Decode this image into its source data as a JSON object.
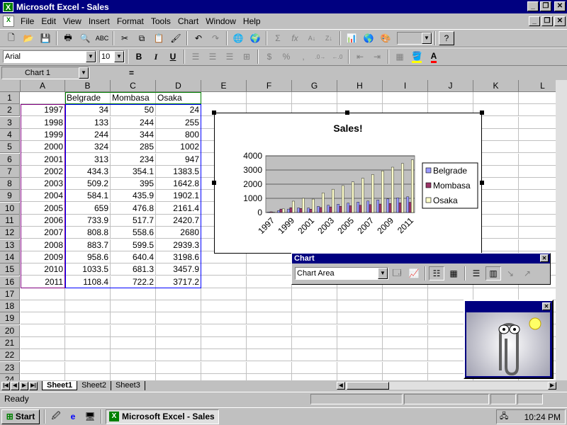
{
  "window": {
    "title": "Microsoft Excel - Sales",
    "minimize": "_",
    "restore": "❐",
    "close": "✕"
  },
  "menu": [
    "File",
    "Edit",
    "View",
    "Insert",
    "Format",
    "Tools",
    "Chart",
    "Window",
    "Help"
  ],
  "toolbar_std": {
    "zoom_value": ""
  },
  "toolbar_fmt": {
    "font": "Arial",
    "size": "10",
    "bold": "B",
    "italic": "I",
    "underline": "U",
    "currency": "$",
    "percent": "%",
    "comma": ","
  },
  "formula_bar": {
    "name_box": "Chart 1",
    "equals": "=",
    "content": ""
  },
  "columns": [
    "A",
    "B",
    "C",
    "D",
    "E",
    "F",
    "G",
    "H",
    "I",
    "J",
    "K",
    "L"
  ],
  "rows": [
    "1",
    "2",
    "3",
    "4",
    "5",
    "6",
    "7",
    "8",
    "9",
    "10",
    "11",
    "12",
    "13",
    "14",
    "15",
    "16",
    "17",
    "18",
    "19",
    "20",
    "21",
    "22",
    "23",
    "24"
  ],
  "sheet": {
    "headers": [
      "Belgrade",
      "Mombasa",
      "Osaka"
    ],
    "data": [
      [
        "1997",
        "34",
        "50",
        "24"
      ],
      [
        "1998",
        "133",
        "244",
        "255"
      ],
      [
        "1999",
        "244",
        "344",
        "800"
      ],
      [
        "2000",
        "324",
        "285",
        "1002"
      ],
      [
        "2001",
        "313",
        "234",
        "947"
      ],
      [
        "2002",
        "434.3",
        "354.1",
        "1383.5"
      ],
      [
        "2003",
        "509.2",
        "395",
        "1642.8"
      ],
      [
        "2004",
        "584.1",
        "435.9",
        "1902.1"
      ],
      [
        "2005",
        "659",
        "476.8",
        "2161.4"
      ],
      [
        "2006",
        "733.9",
        "517.7",
        "2420.7"
      ],
      [
        "2007",
        "808.8",
        "558.6",
        "2680"
      ],
      [
        "2008",
        "883.7",
        "599.5",
        "2939.3"
      ],
      [
        "2009",
        "958.6",
        "640.4",
        "3198.6"
      ],
      [
        "2010",
        "1033.5",
        "681.3",
        "3457.9"
      ],
      [
        "2011",
        "1108.4",
        "722.2",
        "3717.2"
      ]
    ]
  },
  "chart_data": {
    "type": "bar",
    "title": "Sales!",
    "categories": [
      "1997",
      "1998",
      "1999",
      "2000",
      "2001",
      "2002",
      "2003",
      "2004",
      "2005",
      "2006",
      "2007",
      "2008",
      "2009",
      "2010",
      "2011"
    ],
    "x_tick_labels": [
      "1997",
      "1999",
      "2001",
      "2003",
      "2005",
      "2007",
      "2009",
      "2011"
    ],
    "y_ticks": [
      "0",
      "1000",
      "2000",
      "3000",
      "4000"
    ],
    "ylim": [
      0,
      4000
    ],
    "series": [
      {
        "name": "Belgrade",
        "color": "#9999ff",
        "values": [
          34,
          133,
          244,
          324,
          313,
          434.3,
          509.2,
          584.1,
          659,
          733.9,
          808.8,
          883.7,
          958.6,
          1033.5,
          1108.4
        ]
      },
      {
        "name": "Mombasa",
        "color": "#993366",
        "values": [
          50,
          244,
          344,
          285,
          234,
          354.1,
          395,
          435.9,
          476.8,
          517.7,
          558.6,
          599.5,
          640.4,
          681.3,
          722.2
        ]
      },
      {
        "name": "Osaka",
        "color": "#ffffcc",
        "values": [
          24,
          255,
          800,
          1002,
          947,
          1383.5,
          1642.8,
          1902.1,
          2161.4,
          2420.7,
          2680,
          2939.3,
          3198.6,
          3457.9,
          3717.2
        ]
      }
    ],
    "legend_position": "right",
    "plot_bg": "#c0c0c0",
    "grid": true
  },
  "chart_toolbar": {
    "title": "Chart",
    "object": "Chart Area",
    "close": "✕"
  },
  "sheet_tabs": [
    "Sheet1",
    "Sheet2",
    "Sheet3"
  ],
  "status": {
    "text": "Ready"
  },
  "taskbar": {
    "start": "Start",
    "task": "Microsoft Excel - Sales",
    "clock": "10:24 PM"
  }
}
